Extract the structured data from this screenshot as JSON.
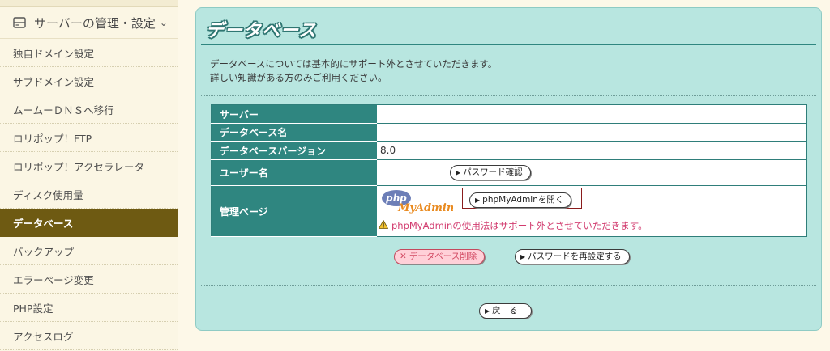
{
  "sidebar": {
    "header_label": "サーバーの管理・設定",
    "items": [
      {
        "label": "独自ドメイン設定",
        "active": false
      },
      {
        "label": "サブドメイン設定",
        "active": false
      },
      {
        "label": "ムームーＤＮＳへ移行",
        "active": false
      },
      {
        "label": "ロリポップ！FTP",
        "active": false
      },
      {
        "label": "ロリポップ！アクセラレータ",
        "active": false
      },
      {
        "label": "ディスク使用量",
        "active": false
      },
      {
        "label": "データベース",
        "active": true
      },
      {
        "label": "バックアップ",
        "active": false
      },
      {
        "label": "エラーページ変更",
        "active": false
      },
      {
        "label": "PHP設定",
        "active": false
      },
      {
        "label": "アクセスログ",
        "active": false
      }
    ]
  },
  "main": {
    "title": "データベース",
    "intro_line1": "データベースについては基本的にサポート外とさせていただきます。",
    "intro_line2": "詳しい知識がある方のみご利用ください。",
    "rows": {
      "server_label": "サーバー",
      "server_value": "",
      "dbname_label": "データベース名",
      "dbname_value": "",
      "version_label": "データベースバージョン",
      "version_value": "8.0",
      "user_label": "ユーザー名",
      "password_confirm_button": "パスワード確認",
      "admin_label": "管理ページ",
      "phpmyadmin_logo_php": "php",
      "phpmyadmin_logo_myadmin": "MyAdmin",
      "open_phpmyadmin_button": "phpMyAdminを開く",
      "warning_text": "phpMyAdminの使用法はサポート外とさせていただきます。"
    },
    "delete_button": "データベース削除",
    "reset_password_button": "パスワードを再設定する",
    "back_button": "戻　る"
  },
  "colors": {
    "accent": "#2f8680",
    "panel_bg": "#b8e6e0",
    "sidebar_active": "#6e5a12",
    "warning": "#d23c6f"
  }
}
